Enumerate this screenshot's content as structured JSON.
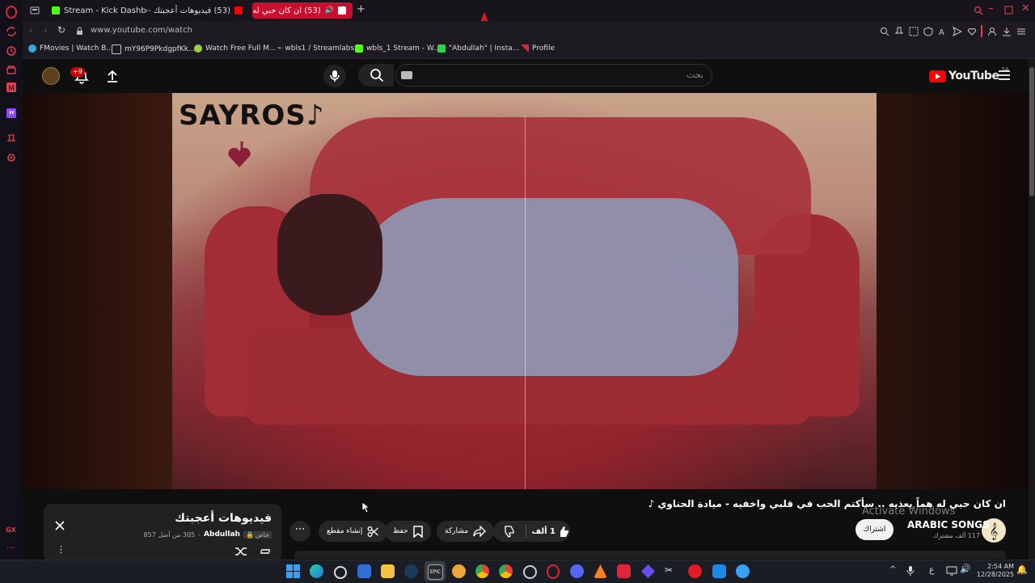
{
  "browser": {
    "tabs": [
      {
        "label": "Stream - Kick Dashboard",
        "active": false
      },
      {
        "label": "(53) فيديوهات أعجبتك - e",
        "active": false
      },
      {
        "label": "(53) ان كان حبي له هماً",
        "active": true
      }
    ],
    "url": "www.youtube.com/watch",
    "bookmarks": [
      "FMovies | Watch B...",
      "mY96P9PkdgpfKk...",
      "Watch Free Full M...",
      "wbls1 / Streamlabs",
      "wbls_1 Stream - W...",
      "\"Abdullah\" | Insta...",
      "Profile"
    ],
    "side_badge": "GX"
  },
  "youtube": {
    "notification_count": "+9",
    "search_placeholder": "بحث",
    "logo_text": "YouTube",
    "region": "SA"
  },
  "video": {
    "watermark": "SAYROS",
    "title": "ان كان حبي له هماً يعذبه .. سأكتم الحب في قلبي واخفيه - ميادة الحناوي ♪",
    "channel": "ARABIC SONGS",
    "subscribers": "117 ألف مشترك",
    "subscribe_label": "اشتراك",
    "likes": "1 ألف",
    "share_label": "مشاركة",
    "save_label": "حفظ",
    "clip_label": "إنشاء مقطع"
  },
  "playlist": {
    "title": "فيديوهات أعجبتك",
    "owner": "Abdullah",
    "privacy": "خاص",
    "position": "305 من أصل 857"
  },
  "windows_watermark": "Activate Windows",
  "taskbar": {
    "lang": "ع",
    "time": "2:54 AM",
    "date": "12/28/2025"
  }
}
